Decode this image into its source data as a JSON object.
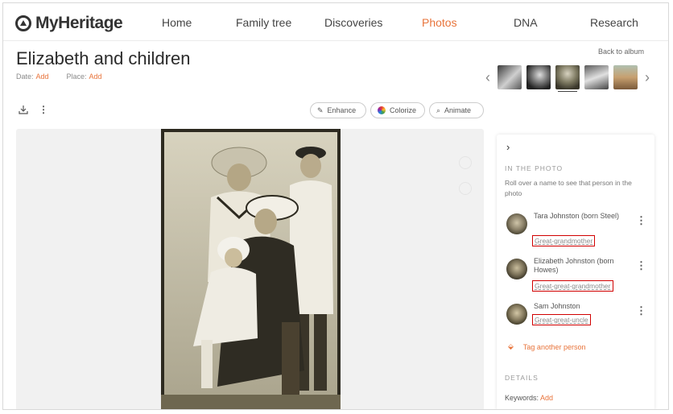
{
  "nav": {
    "brand": "MyHeritage",
    "items": [
      {
        "label": "Home",
        "active": false
      },
      {
        "label": "Family tree",
        "active": false
      },
      {
        "label": "Discoveries",
        "active": false
      },
      {
        "label": "Photos",
        "active": true
      },
      {
        "label": "DNA",
        "active": false
      },
      {
        "label": "Research",
        "active": false
      }
    ]
  },
  "photo": {
    "title": "Elizabeth and children",
    "date_label": "Date:",
    "date_value": "Add",
    "place_label": "Place:",
    "place_value": "Add",
    "back_label": "Back to album"
  },
  "toolbar": {
    "download_icon": "download-icon",
    "more_icon": "more-vert-icon",
    "enhance_label": "Enhance",
    "colorize_label": "Colorize",
    "animate_label": "Animate"
  },
  "panel": {
    "in_photo_heading": "IN THE PHOTO",
    "in_photo_text": "Roll over a name to see that person in the photo",
    "people": [
      {
        "name": "Tara Johnston (born Steel)",
        "relation": "Great-grandmother"
      },
      {
        "name": "Elizabeth Johnston (born Howes)",
        "relation": "Great-great-grandmother"
      },
      {
        "name": "Sam Johnston",
        "relation": "Great-great-uncle"
      }
    ],
    "tag_label": "Tag another person",
    "details_heading": "DETAILS",
    "keywords_label": "Keywords:",
    "keywords_value": "Add"
  },
  "colors": {
    "accent": "#e8743b",
    "highlight_box": "#d10000"
  }
}
